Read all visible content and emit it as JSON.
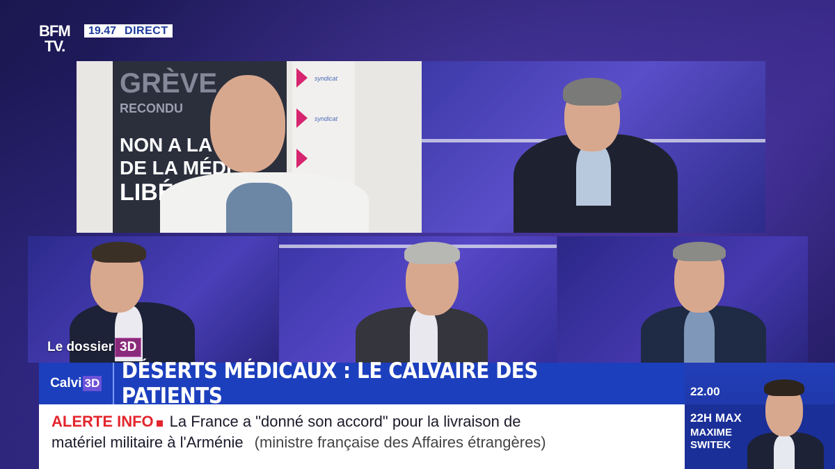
{
  "channel": {
    "logo_line1": "BFM",
    "logo_line2": "TV.",
    "time": "19.47",
    "live": "DIRECT"
  },
  "poster": {
    "line_greve": "GRÈVE",
    "line_recon": "RECONDU",
    "line_non": "NON A LA",
    "line_de": "DE LA MÉDI",
    "line_lib": "LIBÉR",
    "syndicate_label": "syndicat"
  },
  "segment": {
    "label": "Le dossier",
    "badge": "3D"
  },
  "banner": {
    "program": "Calvi",
    "program_badge": "3D",
    "title": "DÉSERTS MÉDICAUX : LE CALVAIRE DES PATIENTS"
  },
  "ticker": {
    "alert_label": "ALERTE INFO",
    "headline_part1": "La France a \"donné son accord\" pour la livraison de",
    "headline_part2": "matériel militaire à l'Arménie",
    "source": "(ministre française des Affaires étrangères)"
  },
  "next_show": {
    "time": "22.00",
    "show": "22H MAX",
    "host_first": "MAXIME",
    "host_last": "SWITEK"
  },
  "colors": {
    "banner_blue": "#1c3fbd",
    "alert_red": "#e3262d",
    "background_purple": "#2a2170"
  }
}
